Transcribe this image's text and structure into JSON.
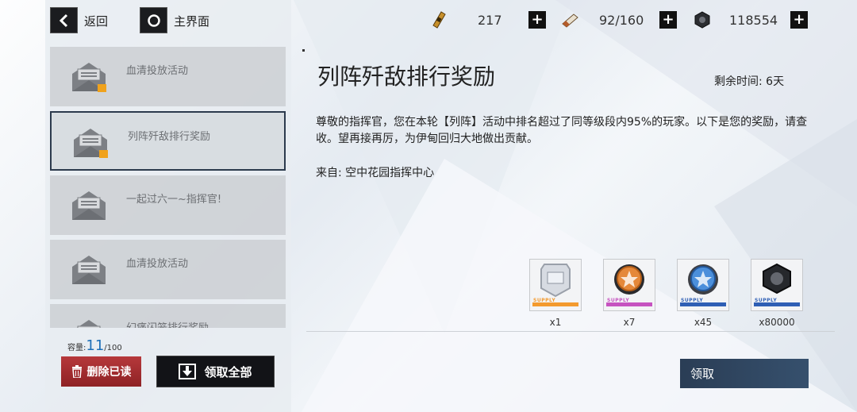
{
  "nav": {
    "back_label": "返回",
    "home_label": "主界面"
  },
  "resources": [
    {
      "icon": "manpower-ticket-icon",
      "value": "217"
    },
    {
      "icon": "ration-icon",
      "value": "92/160"
    },
    {
      "icon": "hex-nut-icon",
      "value": "118554"
    }
  ],
  "mail_list": [
    {
      "title": "血清投放活动",
      "has_attachment": true
    },
    {
      "title": "列阵歼敌排行奖励",
      "has_attachment": true,
      "selected": true
    },
    {
      "title": "一起过六一~指挥官!",
      "has_attachment": false
    },
    {
      "title": "血清投放活动",
      "has_attachment": false
    },
    {
      "title": "幻痛闪笼排行奖励",
      "has_attachment": false
    }
  ],
  "capacity": {
    "label": "容量:",
    "current": "11",
    "max": "/100"
  },
  "buttons": {
    "delete_read": "删除已读",
    "claim_all": "领取全部",
    "claim": "领取"
  },
  "mail": {
    "title": "列阵歼敌排行奖励",
    "time_left": "剩余时间: 6天",
    "body": "尊敬的指挥官，您在本轮【列阵】活动中排名超过了同等级段内95%的玩家。以下是您的奖励，请查收。望再接再厉，为伊甸回归大地做出贡献。",
    "sender": "来自: 空中花园指挥中心"
  },
  "rewards": [
    {
      "icon": "silver-shield-icon",
      "count": "x1",
      "supply": "SUPPLY",
      "accent": "#f39a2e"
    },
    {
      "icon": "orange-coin-icon",
      "count": "x7",
      "supply": "SUPPLY",
      "accent": "#c653c0"
    },
    {
      "icon": "blue-coin-icon",
      "count": "x45",
      "supply": "SUPPLY",
      "accent": "#2f5fb5"
    },
    {
      "icon": "hex-nut-icon",
      "count": "x80000",
      "supply": "SUPPLY",
      "accent": "#2f5fb5"
    }
  ],
  "colors": {
    "delete_button": "#a52d30",
    "claim_button": "#2f4662",
    "capacity_number": "#1d6fb8"
  }
}
